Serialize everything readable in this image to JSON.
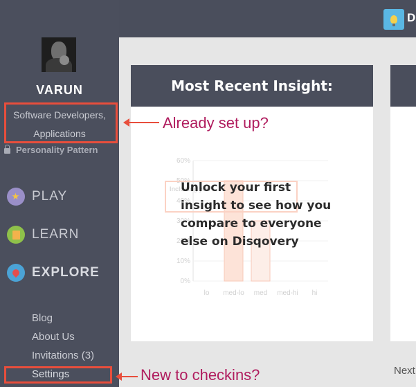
{
  "topbar": {
    "brand_initial": "D",
    "icon": "lightbulb-icon"
  },
  "sidebar": {
    "username": "VARUN",
    "occupation_line1": "Software Developers,",
    "occupation_line2": "Applications",
    "personality_pattern": "Personality Pattern",
    "nav": [
      {
        "label": "PLAY",
        "icon": "star-icon"
      },
      {
        "label": "LEARN",
        "icon": "clipboard-icon"
      },
      {
        "label": "EXPLORE",
        "icon": "pin-icon"
      }
    ],
    "links": [
      "Blog",
      "About Us",
      "Invitations (3)",
      "Settings"
    ]
  },
  "main": {
    "card_title": "Most Recent Insight:",
    "unlock_message": "Unlock your first insight to see how you compare to everyone else on Disqovery",
    "next_label": "Next"
  },
  "annotations": {
    "already_set_up": "Already set up?",
    "new_to_checkins": "New to checkins?"
  },
  "chart_data": {
    "type": "bar",
    "categories": [
      "lo",
      "med-lo",
      "med",
      "med-hi",
      "hi"
    ],
    "y_tick_labels": [
      "0%",
      "10%",
      "20%",
      "30%",
      "40%",
      "50%",
      "60%"
    ],
    "values": [
      0,
      50,
      30,
      0,
      0
    ],
    "legend_text": "Including you",
    "ylim": [
      0,
      60
    ]
  },
  "colors": {
    "accent": "#e84e3c",
    "annotation": "#b01c5e",
    "sidebar": "#4b4f5d"
  }
}
